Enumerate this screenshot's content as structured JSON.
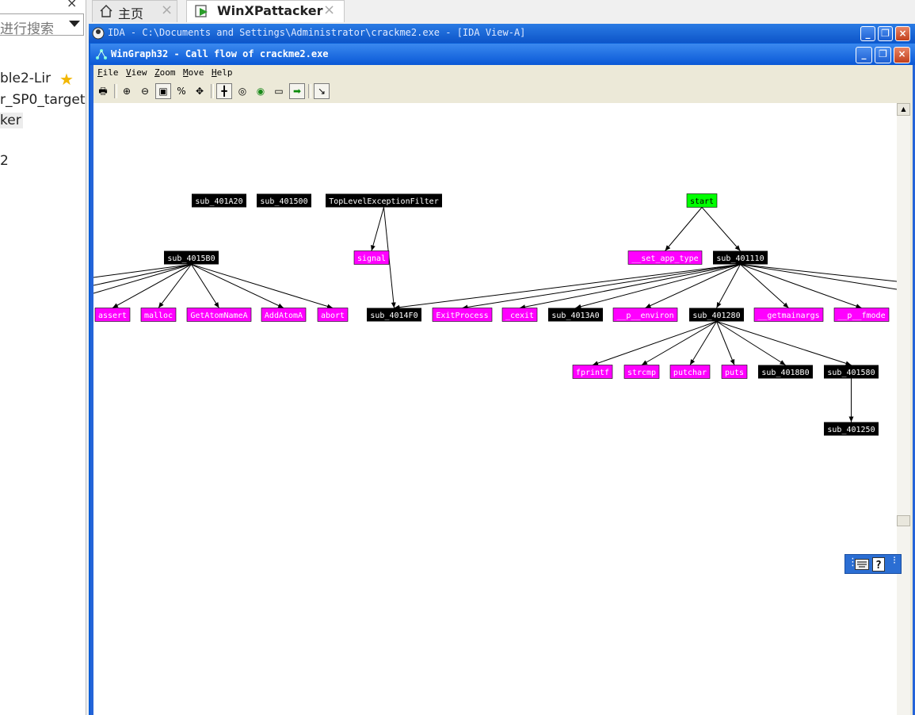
{
  "sidebar": {
    "close_glyph": "×",
    "search_text": "进行搜索",
    "items": [
      "ble2-Lir",
      "r_SP0_target",
      "ker",
      "2"
    ],
    "star": "★"
  },
  "tabs": [
    {
      "label": "主页",
      "icon": "home-icon",
      "close": "×"
    },
    {
      "label": "WinXPattacker",
      "icon": "vm-icon",
      "close": "×"
    }
  ],
  "ida": {
    "title": "IDA - C:\\Documents and Settings\\Administrator\\crackme2.exe - [IDA View-A]",
    "buttons": [
      "_",
      "❐",
      "×"
    ]
  },
  "wingraph": {
    "title": "WinGraph32 - Call flow of crackme2.exe",
    "buttons": [
      "_",
      "❐",
      "×"
    ],
    "menu": [
      {
        "first": "F",
        "rest": "ile"
      },
      {
        "first": "V",
        "rest": "iew"
      },
      {
        "first": "Z",
        "rest": "oom"
      },
      {
        "first": "M",
        "rest": "ove"
      },
      {
        "first": "H",
        "rest": "elp"
      }
    ],
    "toolbar": [
      {
        "name": "print-icon",
        "glyph": "🖶"
      },
      {
        "name": "zoom-in-icon",
        "glyph": "⊕"
      },
      {
        "name": "zoom-out-icon",
        "glyph": "⊖"
      },
      {
        "name": "fit-window-icon",
        "glyph": "▣"
      },
      {
        "name": "zoom-100-icon",
        "glyph": "%"
      },
      {
        "name": "move-icon",
        "glyph": "✥"
      },
      {
        "name": "layout-icon",
        "glyph": "╋"
      },
      {
        "name": "circle-tool-icon",
        "glyph": "◎"
      },
      {
        "name": "navigate-icon",
        "glyph": "◉"
      },
      {
        "name": "overview-icon",
        "glyph": "▭"
      },
      {
        "name": "go-icon",
        "glyph": "➡"
      },
      {
        "name": "arrow-tool-icon",
        "glyph": "↘"
      }
    ],
    "colors": {
      "function": "#000000",
      "library": "#ff00ff",
      "entry": "#00ff00"
    },
    "graph": {
      "nodes": [
        {
          "id": "sub_401A20",
          "label": "sub_401A20",
          "kind": "function"
        },
        {
          "id": "sub_401500",
          "label": "sub_401500",
          "kind": "function"
        },
        {
          "id": "TopLevelExceptionFilter",
          "label": "TopLevelExceptionFilter",
          "kind": "function"
        },
        {
          "id": "start",
          "label": "start",
          "kind": "entry"
        },
        {
          "id": "sub_4015B0",
          "label": "sub_4015B0",
          "kind": "function"
        },
        {
          "id": "signal",
          "label": "signal",
          "kind": "library"
        },
        {
          "id": "__set_app_type",
          "label": "__set_app_type",
          "kind": "library"
        },
        {
          "id": "sub_401110",
          "label": "sub_401110",
          "kind": "function"
        },
        {
          "id": "assert",
          "label": "assert",
          "kind": "library"
        },
        {
          "id": "malloc",
          "label": "malloc",
          "kind": "library"
        },
        {
          "id": "GetAtomNameA",
          "label": "GetAtomNameA",
          "kind": "library"
        },
        {
          "id": "AddAtomA",
          "label": "AddAtomA",
          "kind": "library"
        },
        {
          "id": "abort",
          "label": "abort",
          "kind": "library"
        },
        {
          "id": "sub_4014F0",
          "label": "sub_4014F0",
          "kind": "function"
        },
        {
          "id": "ExitProcess",
          "label": "ExitProcess",
          "kind": "library"
        },
        {
          "id": "_cexit",
          "label": "_cexit",
          "kind": "library"
        },
        {
          "id": "sub_4013A0",
          "label": "sub_4013A0",
          "kind": "function"
        },
        {
          "id": "__p__environ",
          "label": "__p__environ",
          "kind": "library"
        },
        {
          "id": "sub_401280",
          "label": "sub_401280",
          "kind": "function"
        },
        {
          "id": "__getmainargs",
          "label": "__getmainargs",
          "kind": "library"
        },
        {
          "id": "__p__fmode",
          "label": "__p__fmode",
          "kind": "library"
        },
        {
          "id": "fprintf",
          "label": "fprintf",
          "kind": "library"
        },
        {
          "id": "strcmp",
          "label": "strcmp",
          "kind": "library"
        },
        {
          "id": "putchar",
          "label": "putchar",
          "kind": "library"
        },
        {
          "id": "puts",
          "label": "puts",
          "kind": "library"
        },
        {
          "id": "sub_4018B0",
          "label": "sub_4018B0",
          "kind": "function"
        },
        {
          "id": "sub_401580",
          "label": "sub_401580",
          "kind": "function"
        },
        {
          "id": "sub_401250",
          "label": "sub_401250",
          "kind": "function"
        }
      ],
      "edges": [
        [
          "TopLevelExceptionFilter",
          "signal"
        ],
        [
          "TopLevelExceptionFilter",
          "sub_4014F0"
        ],
        [
          "start",
          "__set_app_type"
        ],
        [
          "start",
          "sub_401110"
        ],
        [
          "sub_4015B0",
          "assert"
        ],
        [
          "sub_4015B0",
          "malloc"
        ],
        [
          "sub_4015B0",
          "GetAtomNameA"
        ],
        [
          "sub_4015B0",
          "AddAtomA"
        ],
        [
          "sub_4015B0",
          "abort"
        ],
        [
          "sub_401110",
          "sub_4014F0"
        ],
        [
          "sub_401110",
          "ExitProcess"
        ],
        [
          "sub_401110",
          "_cexit"
        ],
        [
          "sub_401110",
          "sub_4013A0"
        ],
        [
          "sub_401110",
          "__p__environ"
        ],
        [
          "sub_401110",
          "sub_401280"
        ],
        [
          "sub_401110",
          "__getmainargs"
        ],
        [
          "sub_401110",
          "__p__fmode"
        ],
        [
          "sub_401280",
          "fprintf"
        ],
        [
          "sub_401280",
          "strcmp"
        ],
        [
          "sub_401280",
          "putchar"
        ],
        [
          "sub_401280",
          "puts"
        ],
        [
          "sub_401280",
          "sub_4018B0"
        ],
        [
          "sub_401280",
          "sub_401580"
        ],
        [
          "sub_401580",
          "sub_401250"
        ]
      ]
    }
  },
  "mini_toolbar": [
    "keyboard-icon",
    "help-icon"
  ]
}
